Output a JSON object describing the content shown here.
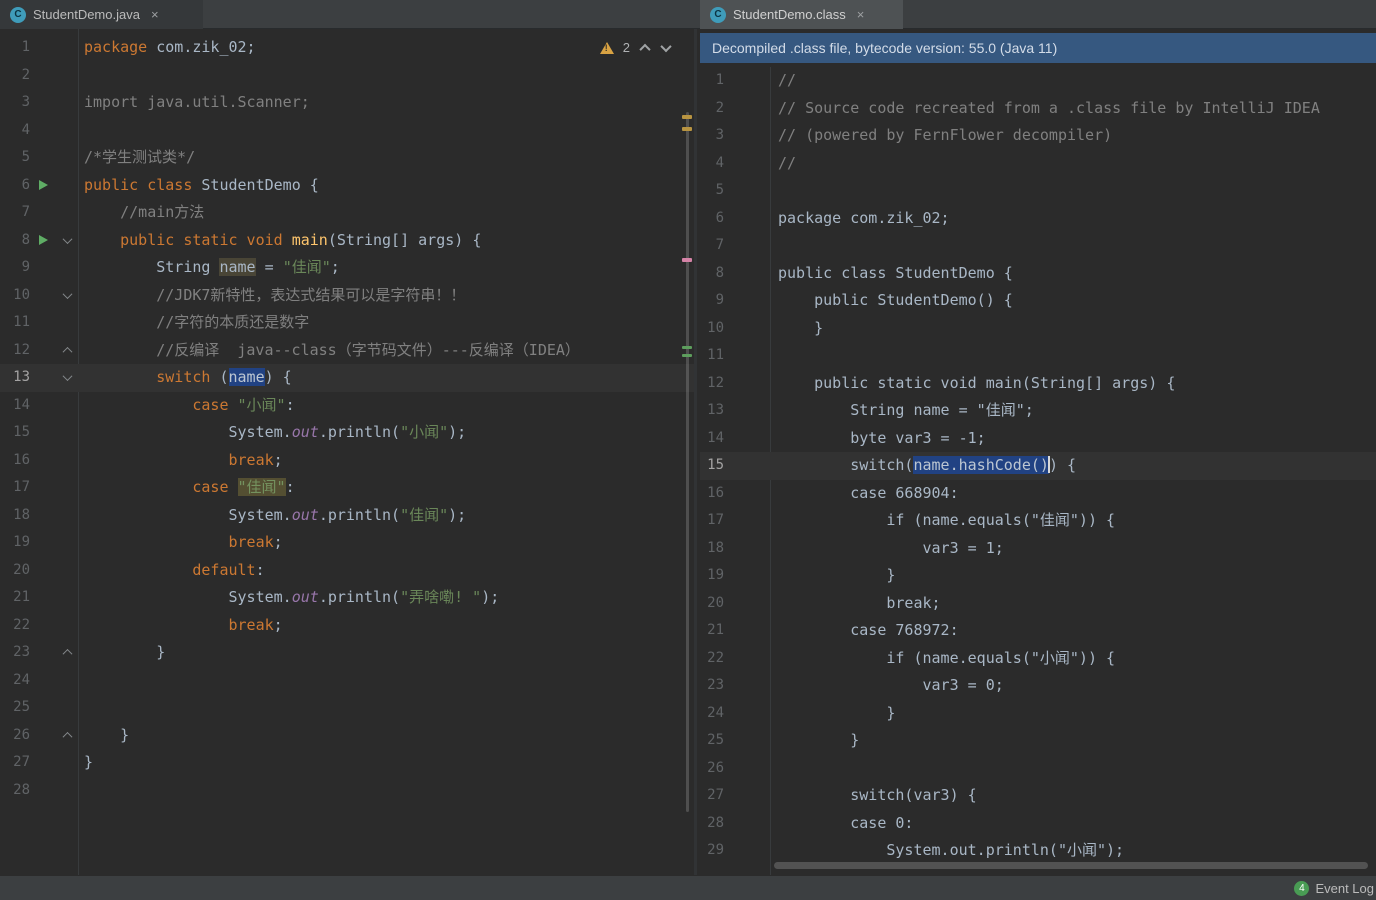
{
  "tabs": [
    {
      "title": "StudentDemo.java",
      "icon_letter": "C",
      "close": "×"
    },
    {
      "title": "StudentDemo.class",
      "icon_letter": "C",
      "close": "×"
    }
  ],
  "banner": {
    "text": "Decompiled .class file, bytecode version: 55.0 (Java 11)"
  },
  "status_bar": {
    "event_log_label": "Event Log",
    "badge": "4"
  },
  "colors": {
    "editor_bg": "#2b2b2b",
    "current_line": "#323232",
    "selection": "#214283",
    "keyword": "#cc7832",
    "string": "#6a8759",
    "comment": "#808080",
    "plain_text": "#a9b7c6",
    "line_number": "#606366",
    "banner_bg": "#365880",
    "run_icon": "#5fad65",
    "warning_icon": "#d9a343",
    "event_badge": "#499c54"
  },
  "left_editor": {
    "file": "StudentDemo.java",
    "warning_count": "2",
    "current_line": 13,
    "lines": [
      {
        "n": 1,
        "t": [
          [
            "kw",
            "package"
          ],
          [
            "pl",
            " com.zik_02;"
          ]
        ]
      },
      {
        "n": 2,
        "t": []
      },
      {
        "n": 3,
        "t": [
          [
            "com",
            "import java.util.Scanner;"
          ]
        ]
      },
      {
        "n": 4,
        "t": []
      },
      {
        "n": 5,
        "t": [
          [
            "com",
            "/*学生测试类*/"
          ]
        ]
      },
      {
        "n": 6,
        "run": true,
        "t": [
          [
            "kw",
            "public class "
          ],
          [
            "pl",
            "StudentDemo {"
          ]
        ]
      },
      {
        "n": 7,
        "t": [
          [
            "pl",
            "    "
          ],
          [
            "com",
            "//main方法"
          ]
        ]
      },
      {
        "n": 8,
        "run": true,
        "fold": "down",
        "t": [
          [
            "pl",
            "    "
          ],
          [
            "kw",
            "public static void "
          ],
          [
            "mth",
            "main"
          ],
          [
            "pl",
            "(String[] args) {"
          ]
        ]
      },
      {
        "n": 9,
        "t": [
          [
            "pl",
            "        String "
          ],
          [
            "occw",
            "name"
          ],
          [
            "pl",
            " = "
          ],
          [
            "str",
            "\"佳闻\""
          ],
          [
            "pl",
            ";"
          ]
        ]
      },
      {
        "n": 10,
        "fold": "down",
        "t": [
          [
            "pl",
            "        "
          ],
          [
            "com",
            "//JDK7新特性，表达式结果可以是字符串！！"
          ]
        ]
      },
      {
        "n": 11,
        "t": [
          [
            "pl",
            "        "
          ],
          [
            "com",
            "//字符的本质还是数字"
          ]
        ]
      },
      {
        "n": 12,
        "fold": "up",
        "t": [
          [
            "pl",
            "        "
          ],
          [
            "com",
            "//反编译  java--class（字节码文件）---反编译（IDEA）"
          ]
        ]
      },
      {
        "n": 13,
        "fold": "down",
        "t": [
          [
            "pl",
            "        "
          ],
          [
            "kw",
            "switch"
          ],
          [
            "pl",
            " ("
          ],
          [
            "sel",
            "name"
          ],
          [
            "pl",
            ") {"
          ]
        ]
      },
      {
        "n": 14,
        "t": [
          [
            "pl",
            "            "
          ],
          [
            "kw",
            "case "
          ],
          [
            "str",
            "\"小闻\""
          ],
          [
            "pl",
            ":"
          ]
        ]
      },
      {
        "n": 15,
        "t": [
          [
            "pl",
            "                System."
          ],
          [
            "fld",
            "out"
          ],
          [
            "pl",
            ".println("
          ],
          [
            "str",
            "\"小闻\""
          ],
          [
            "pl",
            ");"
          ]
        ]
      },
      {
        "n": 16,
        "t": [
          [
            "pl",
            "                "
          ],
          [
            "kw",
            "break"
          ],
          [
            "pl",
            ";"
          ]
        ]
      },
      {
        "n": 17,
        "t": [
          [
            "pl",
            "            "
          ],
          [
            "kw",
            "case "
          ],
          [
            "occy",
            "\"佳闻\""
          ],
          [
            "pl",
            ":"
          ]
        ]
      },
      {
        "n": 18,
        "t": [
          [
            "pl",
            "                System."
          ],
          [
            "fld",
            "out"
          ],
          [
            "pl",
            ".println("
          ],
          [
            "str",
            "\"佳闻\""
          ],
          [
            "pl",
            ");"
          ]
        ]
      },
      {
        "n": 19,
        "t": [
          [
            "pl",
            "                "
          ],
          [
            "kw",
            "break"
          ],
          [
            "pl",
            ";"
          ]
        ]
      },
      {
        "n": 20,
        "t": [
          [
            "pl",
            "            "
          ],
          [
            "kw",
            "default"
          ],
          [
            "pl",
            ":"
          ]
        ]
      },
      {
        "n": 21,
        "t": [
          [
            "pl",
            "                System."
          ],
          [
            "fld",
            "out"
          ],
          [
            "pl",
            ".println("
          ],
          [
            "str",
            "\"弄啥嘞! \""
          ],
          [
            "pl",
            ");"
          ]
        ]
      },
      {
        "n": 22,
        "t": [
          [
            "pl",
            "                "
          ],
          [
            "kw",
            "break"
          ],
          [
            "pl",
            ";"
          ]
        ]
      },
      {
        "n": 23,
        "fold": "up",
        "t": [
          [
            "pl",
            "        }"
          ]
        ]
      },
      {
        "n": 24,
        "t": []
      },
      {
        "n": 25,
        "t": []
      },
      {
        "n": 26,
        "fold": "up",
        "t": [
          [
            "pl",
            "    }"
          ]
        ]
      },
      {
        "n": 27,
        "t": [
          [
            "pl",
            "}"
          ]
        ]
      },
      {
        "n": 28,
        "t": []
      }
    ]
  },
  "right_editor": {
    "file": "StudentDemo.class",
    "current_line": 15,
    "lines": [
      {
        "n": 1,
        "t": [
          [
            "com",
            "//"
          ]
        ]
      },
      {
        "n": 2,
        "t": [
          [
            "com",
            "// Source code recreated from a .class file by IntelliJ IDEA"
          ]
        ]
      },
      {
        "n": 3,
        "t": [
          [
            "com",
            "// (powered by FernFlower decompiler)"
          ]
        ]
      },
      {
        "n": 4,
        "t": [
          [
            "com",
            "//"
          ]
        ]
      },
      {
        "n": 5,
        "t": []
      },
      {
        "n": 6,
        "t": [
          [
            "pl",
            "package com.zik_02;"
          ]
        ]
      },
      {
        "n": 7,
        "t": []
      },
      {
        "n": 8,
        "t": [
          [
            "pl",
            "public class StudentDemo {"
          ]
        ]
      },
      {
        "n": 9,
        "t": [
          [
            "pl",
            "    public StudentDemo() {"
          ]
        ]
      },
      {
        "n": 10,
        "t": [
          [
            "pl",
            "    }"
          ]
        ]
      },
      {
        "n": 11,
        "t": []
      },
      {
        "n": 12,
        "t": [
          [
            "pl",
            "    public static void main(String[] args) {"
          ]
        ]
      },
      {
        "n": 13,
        "t": [
          [
            "pl",
            "        String name = \"佳闻\";"
          ]
        ]
      },
      {
        "n": 14,
        "t": [
          [
            "pl",
            "        byte var3 = -1;"
          ]
        ]
      },
      {
        "n": 15,
        "t": [
          [
            "pl",
            "        switch("
          ],
          [
            "sel",
            "name.hashCode()"
          ],
          [
            "caret",
            ""
          ],
          [
            "pl",
            ") {"
          ]
        ]
      },
      {
        "n": 16,
        "t": [
          [
            "pl",
            "        case 668904:"
          ]
        ]
      },
      {
        "n": 17,
        "t": [
          [
            "pl",
            "            if (name.equals(\"佳闻\")) {"
          ]
        ]
      },
      {
        "n": 18,
        "t": [
          [
            "pl",
            "                var3 = 1;"
          ]
        ]
      },
      {
        "n": 19,
        "t": [
          [
            "pl",
            "            }"
          ]
        ]
      },
      {
        "n": 20,
        "t": [
          [
            "pl",
            "            break;"
          ]
        ]
      },
      {
        "n": 21,
        "t": [
          [
            "pl",
            "        case 768972:"
          ]
        ]
      },
      {
        "n": 22,
        "t": [
          [
            "pl",
            "            if (name.equals(\"小闻\")) {"
          ]
        ]
      },
      {
        "n": 23,
        "t": [
          [
            "pl",
            "                var3 = 0;"
          ]
        ]
      },
      {
        "n": 24,
        "t": [
          [
            "pl",
            "            }"
          ]
        ]
      },
      {
        "n": 25,
        "t": [
          [
            "pl",
            "        }"
          ]
        ]
      },
      {
        "n": 26,
        "t": []
      },
      {
        "n": 27,
        "t": [
          [
            "pl",
            "        switch(var3) {"
          ]
        ]
      },
      {
        "n": 28,
        "t": [
          [
            "pl",
            "        case 0:"
          ]
        ]
      },
      {
        "n": 29,
        "t": [
          [
            "pl",
            "            System.out.println(\"小闻\");"
          ]
        ]
      }
    ]
  }
}
